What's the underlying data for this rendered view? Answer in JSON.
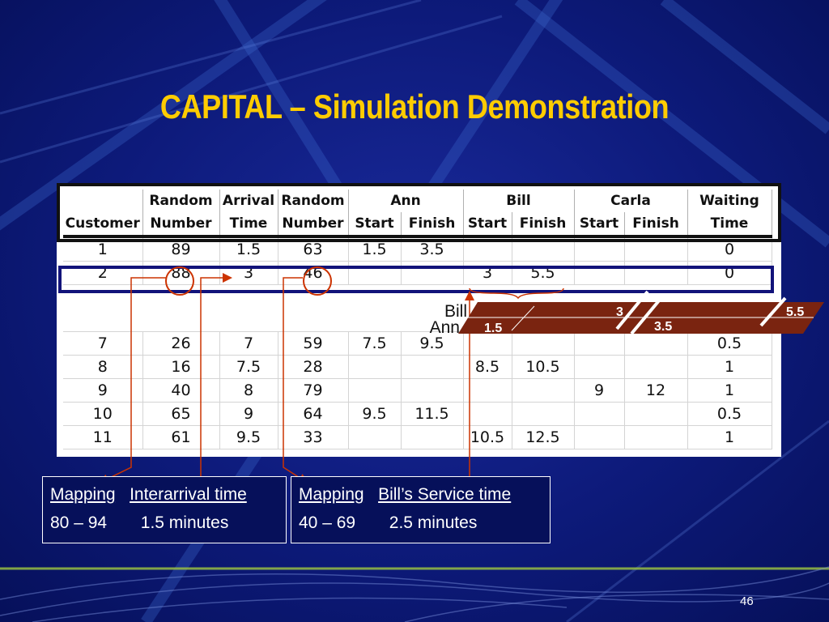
{
  "title": "CAPITAL – Simulation Demonstration",
  "page_number": "46",
  "table": {
    "header_row1": [
      "",
      "Random",
      "Arrival",
      "Random",
      "Ann",
      "Bill",
      "Carla",
      "Waiting"
    ],
    "header_row2": [
      "Customer",
      "Number",
      "Time",
      "Number",
      "Start",
      "Finish",
      "Start",
      "Finish",
      "Start",
      "Finish",
      "Time"
    ],
    "rows_top": [
      [
        "1",
        "89",
        "1.5",
        "63",
        "1.5",
        "3.5",
        "",
        "",
        "",
        "",
        "0"
      ],
      [
        "2",
        "88",
        "3",
        "46",
        "",
        "",
        "3",
        "5.5",
        "",
        "",
        "0"
      ]
    ],
    "rows_bottom": [
      [
        "7",
        "26",
        "7",
        "59",
        "7.5",
        "9.5",
        "",
        "",
        "",
        "",
        "0.5"
      ],
      [
        "8",
        "16",
        "7.5",
        "28",
        "",
        "",
        "8.5",
        "10.5",
        "",
        "",
        "1"
      ],
      [
        "9",
        "40",
        "8",
        "79",
        "",
        "",
        "",
        "",
        "9",
        "12",
        "1"
      ],
      [
        "10",
        "65",
        "9",
        "64",
        "9.5",
        "11.5",
        "",
        "",
        "",
        "",
        "0.5"
      ],
      [
        "11",
        "61",
        "9.5",
        "33",
        "",
        "",
        "10.5",
        "12.5",
        "",
        "",
        "1"
      ]
    ]
  },
  "timeline": {
    "label_bill": "Bill",
    "label_ann": "Ann",
    "val_1_5": "1.5",
    "val_3": "3",
    "val_3_5": "3.5",
    "val_5_5": "5.5"
  },
  "boxes": {
    "left": {
      "mapping": "Mapping",
      "heading": "Interarrival time",
      "range": "80 – 94",
      "result": "1.5 minutes"
    },
    "right": {
      "mapping": "Mapping",
      "heading": "Bill’s Service time",
      "range": "40 – 69",
      "result": "2.5 minutes"
    }
  },
  "colors": {
    "title": "#ffcc00",
    "background": "#0d1a7a",
    "accent_red": "#cc3300",
    "bar": "#7a2410"
  }
}
